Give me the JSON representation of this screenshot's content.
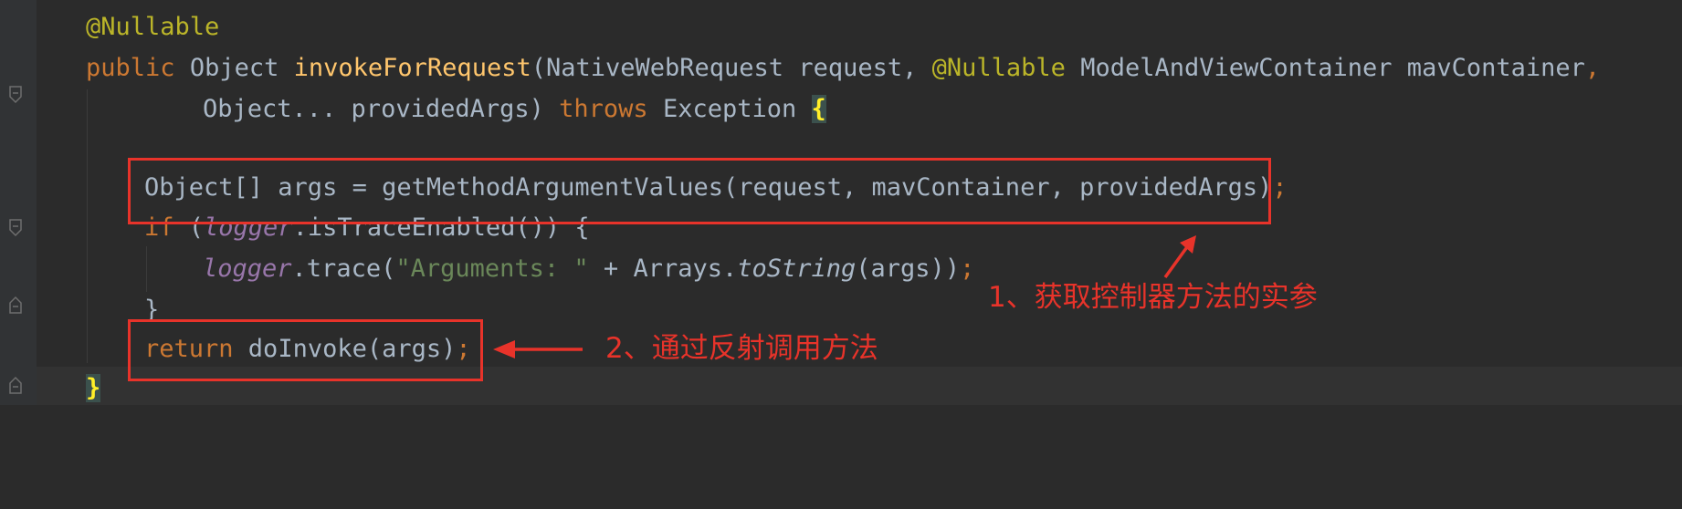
{
  "code": {
    "annotation_nullable": "@Nullable",
    "kw_public": "public",
    "type_object": "Object",
    "method_name": "invokeForRequest",
    "sig_part1": "(NativeWebRequest request, ",
    "annotation_nullable_2": "@Nullable",
    "sig_part2": " ModelAndViewContainer mavContainer",
    "comma": ",",
    "sig_line2_part1": "Object... providedArgs) ",
    "kw_throws": "throws",
    "sig_line2_part2": " Exception ",
    "open_brace": "{",
    "args_line": "Object[] args = getMethodArgumentValues(request, mavContainer, providedArgs)",
    "semicolon": ";",
    "kw_if": "if",
    "if_part1": " (",
    "logger": "logger",
    "if_part2": ".isTraceEnabled()) {",
    "trace_part1": ".trace(",
    "trace_string": "\"Arguments: \"",
    "trace_part2": " + Arrays.",
    "to_string": "toString",
    "trace_part3": "(args))",
    "close_brace_inner": "}",
    "kw_return": "return",
    "return_part": " doInvoke(args)",
    "close_brace_outer": "}"
  },
  "annotations": {
    "callout_1": "1、获取控制器方法的实参",
    "callout_2": "2、通过反射调用方法"
  },
  "colors": {
    "background": "#2b2b2b",
    "default_text": "#a9b7c6",
    "keyword": "#cc7832",
    "annotation": "#bbb529",
    "method": "#ffc66d",
    "string": "#6a8759",
    "field": "#9876aa",
    "callout_red": "#e8332a"
  },
  "icons": [
    "fold-icon",
    "arrow-up-icon",
    "arrow-left-icon"
  ]
}
